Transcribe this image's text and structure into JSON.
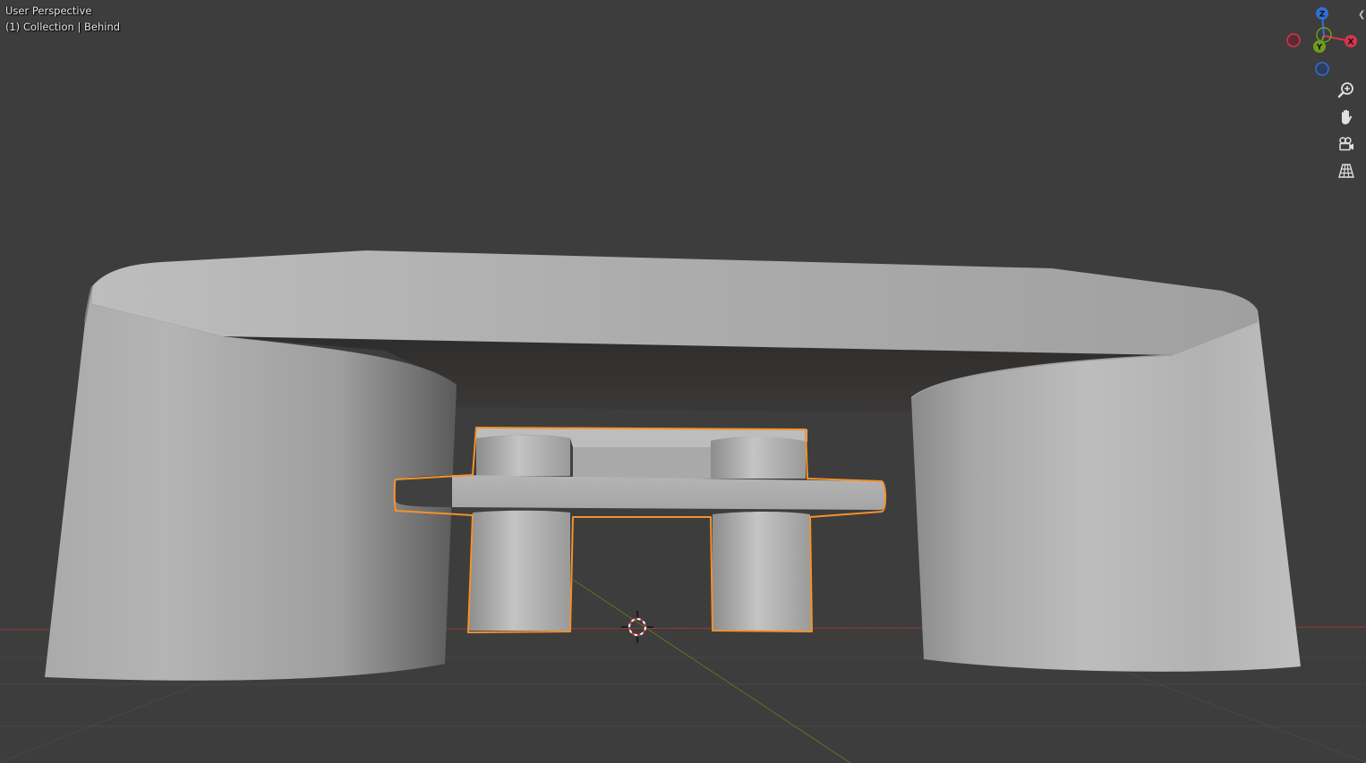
{
  "viewport": {
    "view_name": "User Perspective",
    "collection_line": "(1) Collection | Behind"
  },
  "gizmo": {
    "axes": [
      {
        "name": "Z",
        "color": "#2f6fd6"
      },
      {
        "name": "Y",
        "color": "#6f9d1f"
      },
      {
        "name": "X",
        "color": "#d6354a"
      }
    ],
    "negative_axes": [
      {
        "name": "-X",
        "color": "#d6354a"
      },
      {
        "name": "-Z",
        "color": "#2f6fd6"
      }
    ]
  },
  "nav_buttons": [
    {
      "name": "zoom",
      "icon": "zoom-icon"
    },
    {
      "name": "pan",
      "icon": "hand-icon"
    },
    {
      "name": "camera",
      "icon": "camera-icon"
    },
    {
      "name": "orthographic",
      "icon": "grid-icon"
    }
  ],
  "colors": {
    "background": "#3d3d3d",
    "selection_outline": "#f3922b",
    "axis_x": "#a83a3a",
    "axis_y": "#5e7a2a"
  }
}
